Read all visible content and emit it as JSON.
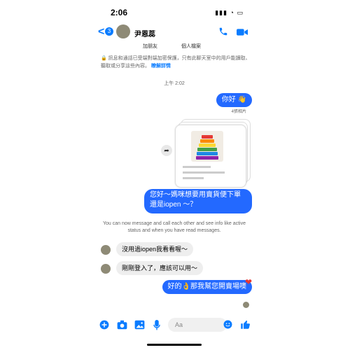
{
  "status": {
    "time": "2:06",
    "signal": "▮▮▮ ◔ ▭"
  },
  "header": {
    "badge": "3",
    "name": "尹恩蕊",
    "back": "<"
  },
  "subtabs": {
    "add_friend": "加朋友",
    "profile": "個人檔案"
  },
  "encryption": {
    "text": "🔒 訊息和通話已受端對端加密保護，只有此聊天室中的用戶能讀取、聽取或分享這些內容。",
    "link": "瞭解詳情"
  },
  "timestamp": "上午 2:02",
  "messages": {
    "out1": "你好 👋",
    "photos_label": "4張相片",
    "out2": "您好～媽咪想要用賣貨便下單還是iopen ～？",
    "info": "You can now message and call each other and see info like active status and when you have read messages.",
    "in1": "沒用過iopen我看看喔～",
    "in2": "剛剛登入了，應該可以用～",
    "out3": "好的👌那我幫您開賣場噢"
  },
  "composer": {
    "placeholder": "Aa"
  },
  "colors": {
    "accent": "#0a7cff",
    "bubble_out": "#2369ff",
    "bubble_in": "#eeeeee"
  },
  "icons": [
    "back-chevron-icon",
    "phone-icon",
    "video-camera-icon",
    "share-icon",
    "plus-icon",
    "camera-icon",
    "image-icon",
    "mic-icon",
    "emoji-icon",
    "thumbs-up-icon",
    "heart-icon"
  ]
}
